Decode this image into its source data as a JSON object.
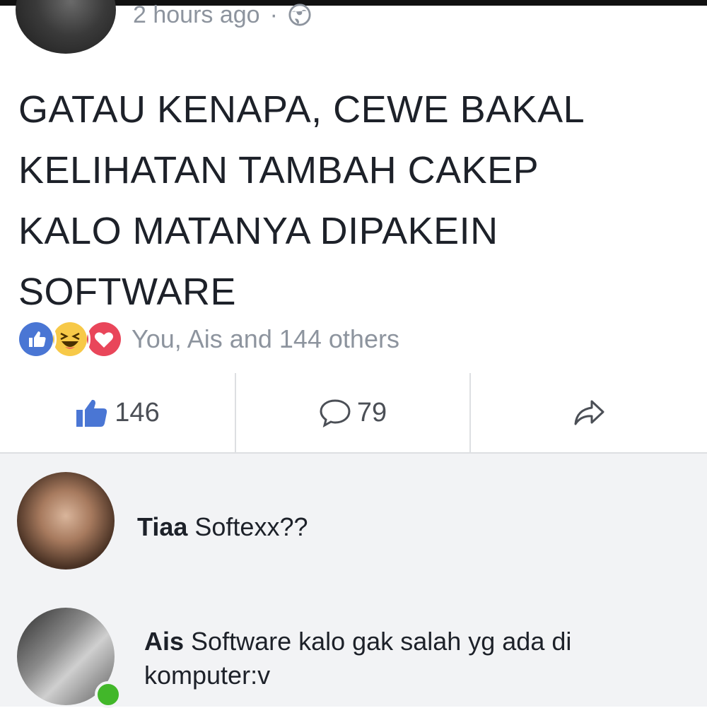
{
  "post": {
    "time": "2 hours ago",
    "separator": "·",
    "privacy_icon": "globe-icon",
    "text_lines": [
      "GATAU KENAPA, CEWE BAKAL",
      "KELIHATAN TAMBAH CAKEP",
      "KALO MATANYA DIPAKEIN",
      "SOFTWARE"
    ]
  },
  "reactions": {
    "icons": [
      "like-reaction-icon",
      "haha-reaction-icon",
      "love-reaction-icon"
    ],
    "summary": "You, Ais and 144 others"
  },
  "actions": {
    "like_count": "146",
    "comment_count": "79",
    "share_icon": "share-icon"
  },
  "comments": [
    {
      "author": "Tiaa",
      "text": "Softexx??"
    },
    {
      "author": "Ais",
      "text": "Software kalo gak salah yg ada di komputer:v",
      "online": true
    }
  ],
  "colors": {
    "like_blue": "#4a76d4",
    "love_red": "#e9465a",
    "haha_yellow": "#f7c948",
    "meta_gray": "#8d949e",
    "online_green": "#42b72a"
  }
}
